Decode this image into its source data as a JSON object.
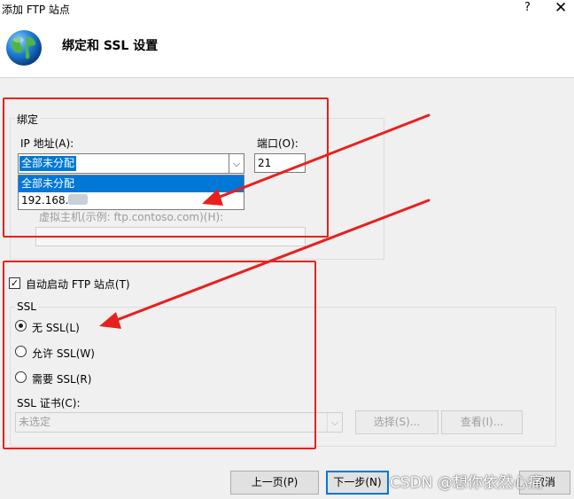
{
  "window": {
    "title": "添加 FTP 站点",
    "help_label": "?",
    "close_label": "✕"
  },
  "header": {
    "icon": "globe-icon",
    "title": "绑定和 SSL 设置"
  },
  "binding": {
    "legend": "绑定",
    "ip_label": "IP 地址(A):",
    "ip_value": "全部未分配",
    "ip_options": [
      "全部未分配",
      "192.168."
    ],
    "port_label": "端口(O):",
    "port_value": "21",
    "virtual_host_label": "虚拟主机(示例: ftp.contoso.com)(H):",
    "virtual_host_value": ""
  },
  "auto_start": {
    "checked": true,
    "check_glyph": "✓",
    "label": "自动启动 FTP 站点(T)"
  },
  "ssl": {
    "legend": "SSL",
    "options": [
      {
        "label": "无 SSL(L)",
        "selected": true
      },
      {
        "label": "允许 SSL(W)",
        "selected": false
      },
      {
        "label": "需要 SSL(R)",
        "selected": false
      }
    ],
    "cert_label": "SSL 证书(C):",
    "cert_value": "未选定",
    "select_button": "选择(S)...",
    "view_button": "查看(I)..."
  },
  "footer": {
    "prev_button": "上一页(P)",
    "next_button": "下一步(N)",
    "cancel_button": "取消"
  },
  "watermark": "CSDN @想你依然心痛",
  "colors": {
    "annotation": "#e8201c",
    "selection": "#0078d7"
  }
}
